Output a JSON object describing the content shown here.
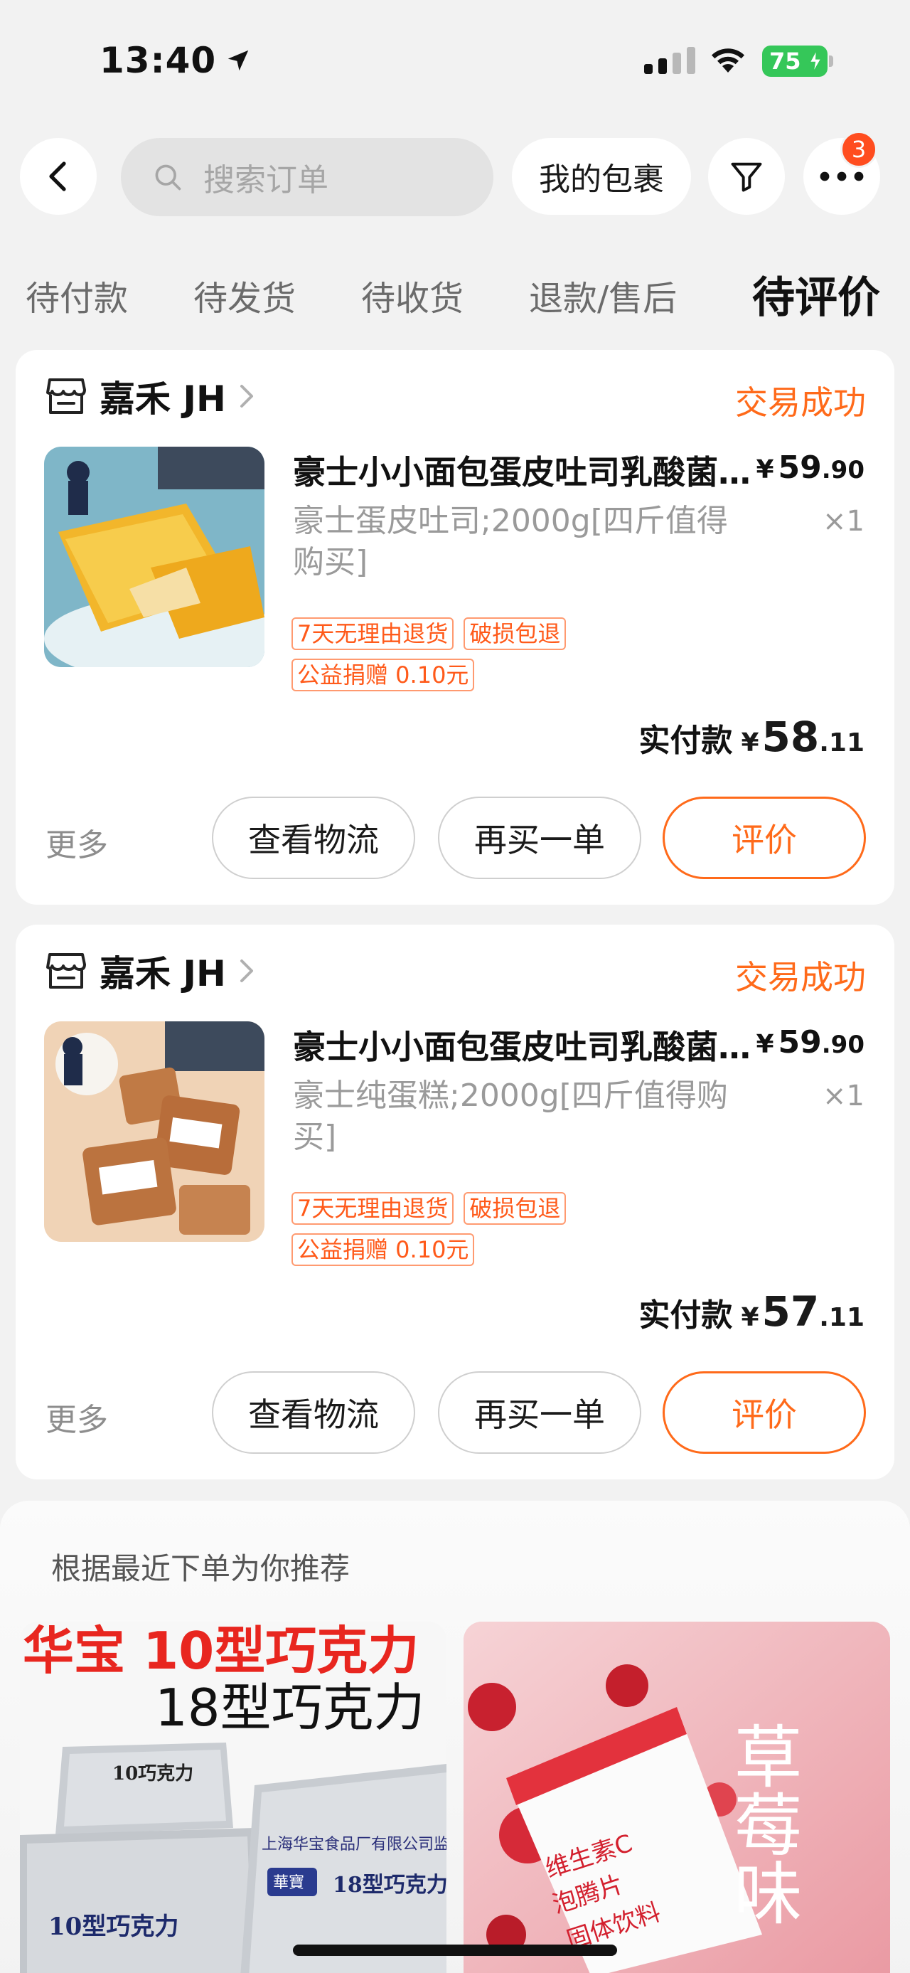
{
  "status_bar": {
    "time": "13:40",
    "battery": "75"
  },
  "header": {
    "search_placeholder": "搜索订单",
    "parcel_label": "我的包裹",
    "notification_count": "3"
  },
  "tabs": [
    {
      "label": "待付款"
    },
    {
      "label": "待发货"
    },
    {
      "label": "待收货"
    },
    {
      "label": "退款/售后"
    },
    {
      "label": "待评价",
      "active": true
    }
  ],
  "orders": [
    {
      "shop": "嘉禾 JH",
      "status": "交易成功",
      "title": "豪士小小面包蛋皮吐司乳酸菌夹心早餐面包",
      "price_int": "59",
      "price_dec": ".90",
      "spec": "豪士蛋皮吐司;2000g[四斤值得购买]",
      "qty": "×1",
      "tags": [
        "7天无理由退货",
        "破损包退"
      ],
      "charity": "公益捐赠 0.10元",
      "paid_label": "实付款",
      "paid_int": "58",
      "paid_dec": ".11",
      "more": "更多",
      "btn_logistics": "查看物流",
      "btn_rebuy": "再买一单",
      "btn_review": "评价"
    },
    {
      "shop": "嘉禾 JH",
      "status": "交易成功",
      "title": "豪士小小面包蛋皮吐司乳酸菌夹心早餐面包",
      "price_int": "59",
      "price_dec": ".90",
      "spec": "豪士纯蛋糕;2000g[四斤值得购买]",
      "qty": "×1",
      "tags": [
        "7天无理由退货",
        "破损包退"
      ],
      "charity": "公益捐赠 0.10元",
      "paid_label": "实付款",
      "paid_int": "57",
      "paid_dec": ".11",
      "more": "更多",
      "btn_logistics": "查看物流",
      "btn_rebuy": "再买一单",
      "btn_review": "评价"
    }
  ],
  "currency": "¥",
  "recommend": {
    "title": "根据最近下单为你推荐",
    "item1": {
      "headline": "华宝 10型巧克力",
      "subline": "18型巧克力",
      "pack_a": "10巧克力",
      "pack_b": "10型巧克力",
      "pack_c": "18型巧克力",
      "maker": "上海华宝食品厂有限公司监制",
      "brand": "華寶"
    },
    "item2": {
      "flavor": "草莓味",
      "label_a": "维生素C",
      "label_b": "泡腾片",
      "label_c": "固体饮料"
    }
  },
  "colors": {
    "accent": "#ff6a1a",
    "badge": "#ff4d1f",
    "battery": "#35c759"
  }
}
